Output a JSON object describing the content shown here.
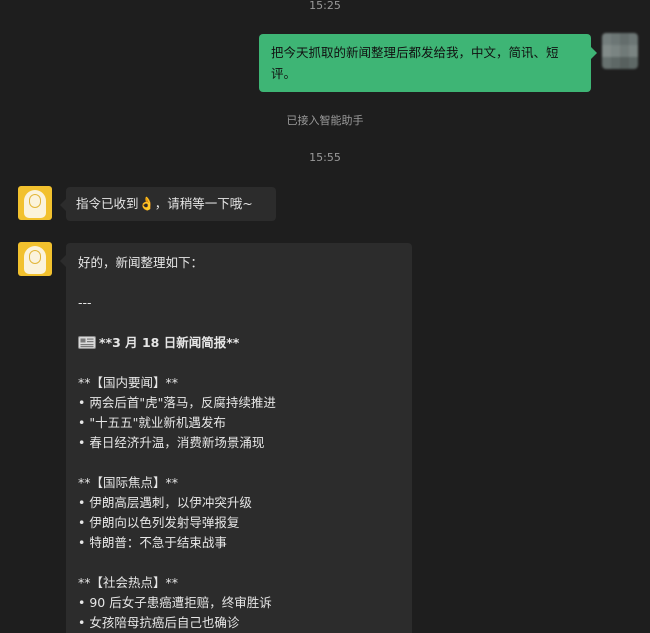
{
  "timestamps": [
    "15:25",
    "15:55"
  ],
  "system_notice": "已接入智能助手",
  "user_message": "把今天抓取的新闻整理后都发给我，中文，简讯、短评。",
  "bot_reply_1": {
    "before_emoji": "指令已收到",
    "emoji": "👌",
    "after_emoji": "，请稍等一下哦~"
  },
  "bot_reply_2": {
    "intro": "好的，新闻整理如下：",
    "separator": "---",
    "newspaper_icon": "newspaper-icon",
    "headline": "**3 月 18 日新闻简报**",
    "sections": [
      {
        "heading": "**【国内要闻】**",
        "items": [
          "• 两会后首\"虎\"落马，反腐持续推进",
          "• \"十五五\"就业新机遇发布",
          "• 春日经济升温，消费新场景涌现"
        ]
      },
      {
        "heading": "**【国际焦点】**",
        "items": [
          "• 伊朗高层遇刺，以伊冲突升级",
          "• 伊朗向以色列发射导弹报复",
          "• 特朗普：不急于结束战事"
        ]
      },
      {
        "heading": "**【社会热点】**",
        "items": [
          "• 90 后女子患癌遭拒赔，终审胜诉",
          "• 女孩陪母抗癌后自己也确诊"
        ]
      }
    ]
  },
  "colors": {
    "background": "#1e1e1e",
    "user_bubble": "#3eb575",
    "bot_bubble": "#2c2c2c",
    "muted_text": "#9a9a9a"
  }
}
